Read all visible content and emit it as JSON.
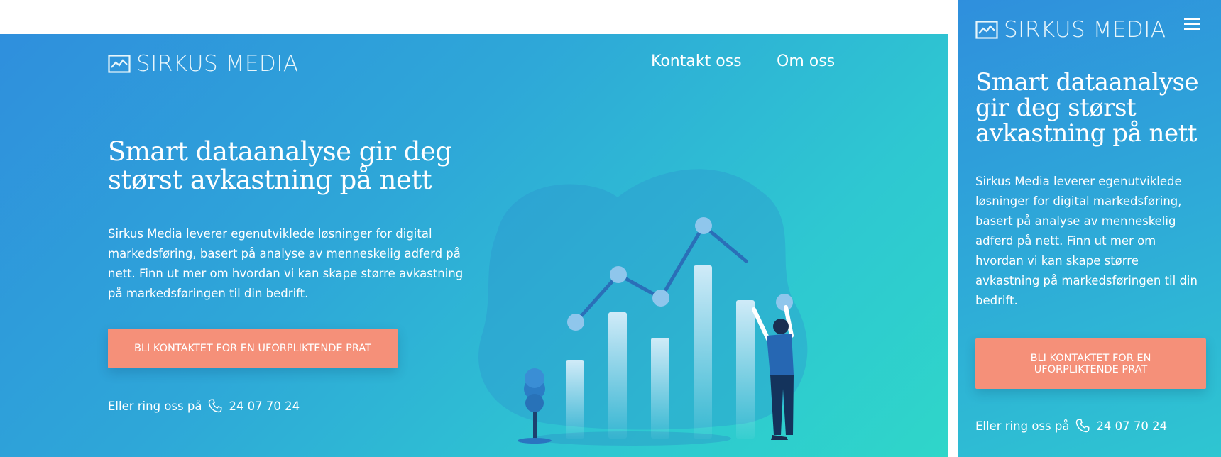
{
  "brand": {
    "name": "SIRKUS MEDIA",
    "icon": "line-chart-icon"
  },
  "nav": [
    {
      "label": "Kontakt oss"
    },
    {
      "label": "Om oss"
    }
  ],
  "hero": {
    "headline": "Smart dataanalyse gir deg størst avkastning på nett",
    "paragraph": "Sirkus Media leverer egenutviklede løsninger for digital markedsføring, basert på analyse av menneskelig adferd på nett. Finn ut mer om hvordan vi kan skape større avkastning på markedsføringen til din bedrift.",
    "cta_label": "BLI KONTAKTET FOR EN UFORPLIKTENDE PRAT",
    "call_prefix": "Eller ring oss på",
    "phone_icon": "phone-icon",
    "phone_number": "24 07 70 24"
  },
  "mobile": {
    "menu_icon": "hamburger-menu-icon"
  },
  "colors": {
    "gradient_start": "#2f8fdd",
    "gradient_end": "#2fd6c9",
    "cta_background": "#f59079",
    "text": "#ffffff"
  }
}
